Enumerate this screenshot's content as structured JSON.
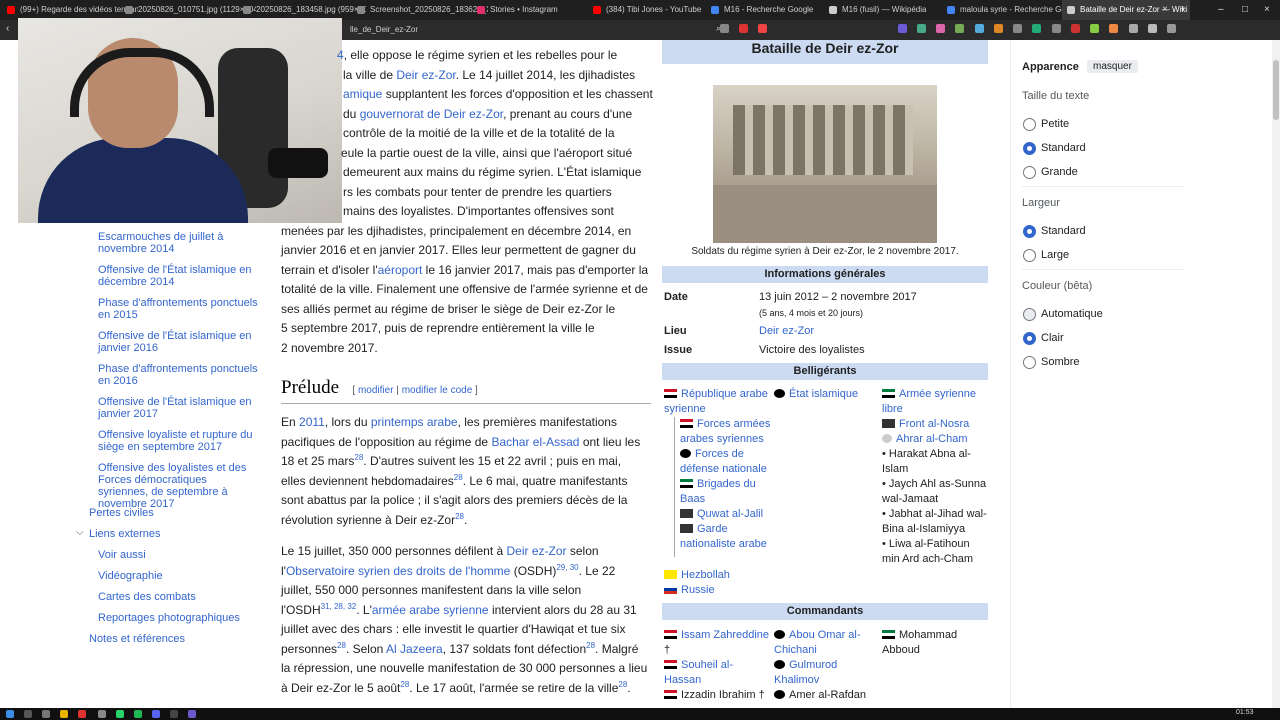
{
  "browser": {
    "tabs": [
      {
        "label": "(99+) Regarde des vidéos tendanc",
        "color": "#ff0000"
      },
      {
        "label": "20250826_010751.jpg (1129×2048)",
        "color": "#888888"
      },
      {
        "label": "20250826_183458.jpg (959×1063)",
        "color": "#888888"
      },
      {
        "label": "Screenshot_20250826_183622_X.jpg",
        "color": "#888888"
      },
      {
        "label": "Stories • Instagram",
        "color": "#e1306c"
      },
      {
        "label": "(384) Tibi Jones - YouTube",
        "color": "#ff0000"
      },
      {
        "label": "M16 - Recherche Google",
        "color": "#4285f4"
      },
      {
        "label": "M16 (fusil) — Wikipédia",
        "color": "#cccccc"
      },
      {
        "label": "maloula syrie - Recherche Google",
        "color": "#4285f4"
      },
      {
        "label": "Bataille de Deir ez-Zor — Wiki",
        "color": "#cccccc"
      }
    ],
    "url": "lle_de_Deir_ez-Zor",
    "new_tab": "+"
  },
  "toc": {
    "items": [
      "Escarmouches de juillet à novembre 2014",
      "Offensive de l'État islamique en décembre 2014",
      "Phase d'affrontements ponctuels en 2015",
      "Offensive de l'État islamique en janvier 2016",
      "Phase d'affrontements ponctuels en 2016",
      "Offensive de l'État islamique en janvier 2017",
      "Offensive loyaliste et rupture du siège en septembre 2017",
      "Offensive des loyalistes et des Forces démocratiques syriennes, de septembre à novembre 2017",
      "Pertes civiles",
      "Liens externes",
      "Voir aussi",
      "Vidéographie",
      "Cartes des combats",
      "Reportages photographiques",
      "Notes et références"
    ]
  },
  "article": {
    "p1": {
      "l1a": "4",
      "l1b": ", elle oppose le régime syrien et les rebelles pour le",
      "l2a": "la ville de ",
      "l2link": "Deir ez-Zor",
      "l2b": ". Le 14 juillet 2014, les djihadistes",
      "l3link": "amique",
      "l3b": " supplantent les forces d'opposition et les chassent",
      "l4a": "du ",
      "l4link": "gouvernorat de Deir ez-Zor",
      "l4b": ", prenant au cours d'une",
      "l5": "contrôle de la moitié de la ville et de la totalité de la",
      "l6": "eule la partie ouest de la ville, ainsi que l'aéroport situé",
      "l7": "demeurent aux mains du régime syrien. L'État islamique",
      "l8": "rs les combats pour tenter de prendre les quartiers",
      "l9": "mains des loyalistes. D'importantes offensives sont",
      "l10": "menées par les djihadistes, principalement en décembre 2014, en",
      "l11": "janvier 2016 et en janvier 2017. Elles leur permettent de gagner du",
      "l12a": "terrain et d'isoler l'",
      "l12link": "aéroport",
      "l12b": " le 16 janvier 2017, mais pas d'emporter la",
      "l13": "totalité de la ville. Finalement une offensive de l'armée syrienne et de",
      "l14": "ses alliés permet au régime de briser le siège de Deir ez-Zor le",
      "l15": "5 septembre 2017, puis de reprendre entièrement la ville le",
      "l16": "2 novembre 2017."
    },
    "prelude": {
      "title": "Prélude",
      "bracket_open": "[ ",
      "edit": "modifier",
      "sep": " | ",
      "edit_code": "modifier le code",
      "bracket_close": " ]"
    },
    "p2": {
      "l1a": "En ",
      "l1link1": "2011",
      "l1b": ", lors du ",
      "l1link2": "printemps arabe",
      "l1c": ", les premières manifestations",
      "l2a": "pacifiques de l'opposition au régime de ",
      "l2link": "Bachar el-Assad",
      "l2b": " ont lieu les",
      "l3a": "18 et 25 mars",
      "ref28": "28",
      "l3b": ". D'autres suivent les 15 et 22 avril ; puis en mai,",
      "l4a": "elles deviennent hebdomadaires",
      "l4b": ". Le 6 mai, quatre manifestants",
      "l5": "sont abattus par la police ; il s'agit alors des premiers décès de la",
      "l6a": "révolution syrienne à Deir ez-Zor",
      "l6b": "."
    },
    "p3": {
      "l1a": "Le 15 juillet, 350 000 personnes défilent à ",
      "l1link": "Deir ez-Zor",
      "l1b": " selon",
      "l2a": "l'",
      "l2link": "Observatoire syrien des droits de l'homme",
      "l2b": " (OSDH)",
      "ref2930": "29, 30",
      "l2c": ". Le 22",
      "l3": "juillet, 550 000 personnes manifestent dans la ville selon",
      "l4a": "l'OSDH",
      "ref313228": "31, 28, 32",
      "l4b": ". L'",
      "l4link": "armée arabe syrienne",
      "l4c": " intervient alors du 28 au 31",
      "l5": "juillet avec des chars : elle investit le quartier d'Hawiqat et tue six",
      "l6a": "personnes",
      "l6b": ". Selon ",
      "l6link": "Al Jazeera",
      "l6c": ", 137 soldats font défection",
      "l6d": ". Malgré",
      "l7": "la répression, une nouvelle manifestation de 30 000 personnes a lieu",
      "l8a": "à Deir ez-Zor le 5 août",
      "l8b": ". Le 17 août, l'armée se retire de la ville",
      "l8c": "."
    }
  },
  "infobox": {
    "title": "Bataille de Deir ez-Zor",
    "caption": "Soldats du régime syrien à Deir ez-Zor, le 2 novembre 2017.",
    "general_header": "Informations générales",
    "date_label": "Date",
    "date_value": "13 juin 2012 – 2 novembre 2017",
    "date_sub": "(5 ans, 4 mois et 20 jours)",
    "lieu_label": "Lieu",
    "lieu_value": "Deir ez-Zor",
    "issue_label": "Issue",
    "issue_value": "Victoire des loyalistes",
    "belligerents_header": "Belligérants",
    "col1": {
      "main": "République arabe syrienne",
      "sub": [
        "Forces armées arabes syriennes",
        "Forces de défense nationale",
        "Brigades du Baas",
        "Quwat al-Jalil",
        "Garde nationaliste arabe"
      ],
      "allies": [
        "Hezbollah",
        "Russie"
      ]
    },
    "col2": {
      "main": "État islamique"
    },
    "col3": {
      "main": "Armée syrienne libre",
      "items": [
        "Front al-Nosra",
        "Ahrar al-Cham"
      ],
      "bullets": [
        "• Harakat Abna al-Islam",
        "• Jaych Ahl as-Sunna wal-Jamaat",
        "• Jabhat al-Jihad wal-Bina al-Islamiyya",
        "• Liwa al-Fatihoun min Ard ach-Cham"
      ]
    },
    "commanders_header": "Commandants",
    "commanders": {
      "c1": [
        "Issam Zahreddine",
        "Souheil al-Hassan",
        "Izzadin Ibrahim"
      ],
      "c2": [
        "Abou Omar al-Chichani",
        "Gulmurod Khalimov",
        "Amer al-Rafdan"
      ],
      "c3": [
        "Mohammad Abboud"
      ],
      "dagger": " †"
    }
  },
  "appearance": {
    "title": "Apparence",
    "hide": "masquer",
    "text_size_label": "Taille du texte",
    "text_size_options": [
      "Petite",
      "Standard",
      "Grande"
    ],
    "text_size_selected": 1,
    "width_label": "Largeur",
    "width_options": [
      "Standard",
      "Large"
    ],
    "width_selected": 0,
    "color_label": "Couleur (bêta)",
    "color_options": [
      "Automatique",
      "Clair",
      "Sombre"
    ],
    "color_selected": 1
  },
  "taskbar": {
    "time": "01:53"
  }
}
